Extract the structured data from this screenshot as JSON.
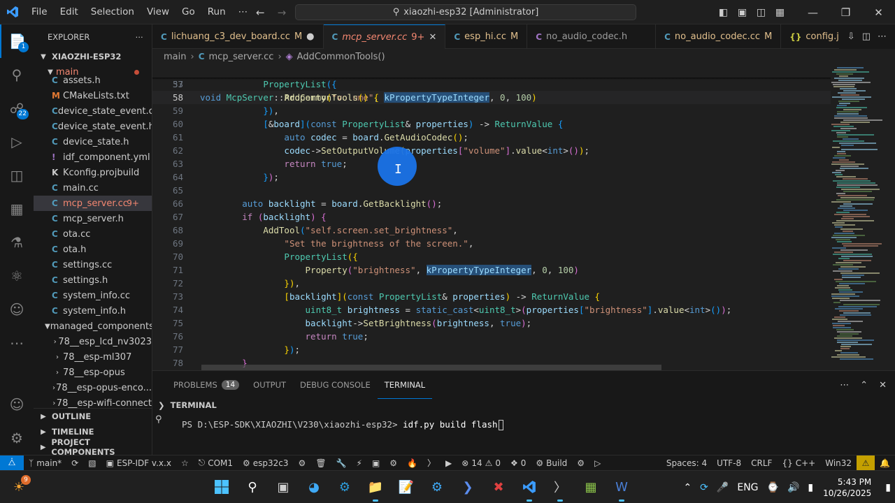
{
  "menu": [
    "File",
    "Edit",
    "Selection",
    "View",
    "Go",
    "Run",
    "⋯"
  ],
  "command_center": "xiaozhi-esp32 [Administrator]",
  "activity": {
    "explorer_badge": "1",
    "scm_badge": "22"
  },
  "sidebar": {
    "title": "EXPLORER",
    "root": "XIAOZHI-ESP32",
    "folder_main": "main",
    "files": [
      {
        "name": "assets.h",
        "icon": "C",
        "kind": "c"
      },
      {
        "name": "CMakeLists.txt",
        "icon": "M",
        "kind": "m"
      },
      {
        "name": "device_state_event.cc",
        "icon": "C",
        "kind": "c"
      },
      {
        "name": "device_state_event.h",
        "icon": "C",
        "kind": "c"
      },
      {
        "name": "device_state.h",
        "icon": "C",
        "kind": "c"
      },
      {
        "name": "idf_component.yml",
        "icon": "!",
        "kind": "y"
      },
      {
        "name": "Kconfig.projbuild",
        "icon": "K",
        "kind": "k"
      },
      {
        "name": "main.cc",
        "icon": "C",
        "kind": "c"
      },
      {
        "name": "mcp_server.cc",
        "icon": "C",
        "kind": "c",
        "badge": "9+",
        "selected": true
      },
      {
        "name": "mcp_server.h",
        "icon": "C",
        "kind": "c"
      },
      {
        "name": "ota.cc",
        "icon": "C",
        "kind": "c"
      },
      {
        "name": "ota.h",
        "icon": "C",
        "kind": "c"
      },
      {
        "name": "settings.cc",
        "icon": "C",
        "kind": "c"
      },
      {
        "name": "settings.h",
        "icon": "C",
        "kind": "c"
      },
      {
        "name": "system_info.cc",
        "icon": "C",
        "kind": "c"
      },
      {
        "name": "system_info.h",
        "icon": "C",
        "kind": "c"
      }
    ],
    "managed_folder": "managed_components",
    "managed": [
      "78__esp_lcd_nv3023",
      "78__esp-ml307",
      "78__esp-opus",
      "78__esp-opus-enco...",
      "78__esp-wifi-connect"
    ],
    "sections": [
      "OUTLINE",
      "TIMELINE",
      "PROJECT COMPONENTS"
    ]
  },
  "tabs": [
    {
      "name": "lichuang_c3_dev_board.cc",
      "mark": "M",
      "dirty": true
    },
    {
      "name": "mcp_server.cc",
      "mark": "9+",
      "active": true
    },
    {
      "name": "esp_hi.cc",
      "mark": "M"
    },
    {
      "name": "no_audio_codec.h",
      "mark": ""
    },
    {
      "name": "no_audio_codec.cc",
      "mark": "M"
    },
    {
      "name": "config.json",
      "mark": "M",
      "json": true
    }
  ],
  "breadcrumb": [
    "main",
    "mcp_server.cc",
    "AddCommonTools()"
  ],
  "code": {
    "sticky": {
      "num": "33",
      "text": "void McpServer::AddCommonTools() {"
    },
    "lines": [
      {
        "num": "57"
      },
      {
        "num": "58"
      },
      {
        "num": "59"
      },
      {
        "num": "60"
      },
      {
        "num": "61"
      },
      {
        "num": "62"
      },
      {
        "num": "63"
      },
      {
        "num": "64"
      },
      {
        "num": "65"
      },
      {
        "num": "66"
      },
      {
        "num": "67"
      },
      {
        "num": "68"
      },
      {
        "num": "69"
      },
      {
        "num": "70"
      },
      {
        "num": "71"
      },
      {
        "num": "72"
      },
      {
        "num": "73"
      },
      {
        "num": "74"
      },
      {
        "num": "75"
      },
      {
        "num": "76"
      },
      {
        "num": "77"
      },
      {
        "num": "78"
      }
    ]
  },
  "panel": {
    "tabs": [
      "PROBLEMS",
      "OUTPUT",
      "DEBUG CONSOLE",
      "TERMINAL"
    ],
    "problems_count": "14",
    "terminal_title": "TERMINAL",
    "prompt": "PS D:\\ESP-SDK\\XIAOZHI\\V230\\xiaozhi-esp32> ",
    "command": "idf.py build flash"
  },
  "status": {
    "branch": "main*",
    "idf": "ESP-IDF v.x.x",
    "port": "COM1",
    "target": "esp32c3",
    "errors": "14",
    "warnings": "0",
    "info": "0",
    "build": "Build",
    "spaces": "Spaces: 4",
    "encoding": "UTF-8",
    "eol": "CRLF",
    "lang": "C++",
    "platform": "Win32"
  },
  "taskbar": {
    "lang": "ENG",
    "time": "5:43 PM",
    "date": "10/26/2025",
    "notif_badge": "9"
  }
}
